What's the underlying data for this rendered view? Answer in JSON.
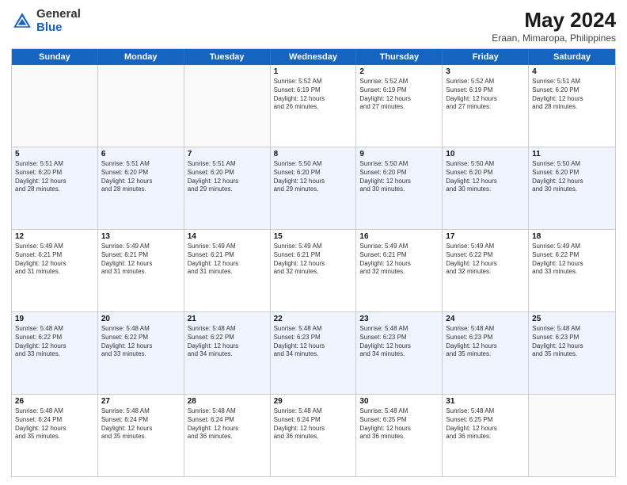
{
  "header": {
    "logo_general": "General",
    "logo_blue": "Blue",
    "month_year": "May 2024",
    "location": "Eraan, Mimaropa, Philippines"
  },
  "days_of_week": [
    "Sunday",
    "Monday",
    "Tuesday",
    "Wednesday",
    "Thursday",
    "Friday",
    "Saturday"
  ],
  "weeks": [
    [
      {
        "day": "",
        "info": ""
      },
      {
        "day": "",
        "info": ""
      },
      {
        "day": "",
        "info": ""
      },
      {
        "day": "1",
        "info": "Sunrise: 5:52 AM\nSunset: 6:19 PM\nDaylight: 12 hours\nand 26 minutes."
      },
      {
        "day": "2",
        "info": "Sunrise: 5:52 AM\nSunset: 6:19 PM\nDaylight: 12 hours\nand 27 minutes."
      },
      {
        "day": "3",
        "info": "Sunrise: 5:52 AM\nSunset: 6:19 PM\nDaylight: 12 hours\nand 27 minutes."
      },
      {
        "day": "4",
        "info": "Sunrise: 5:51 AM\nSunset: 6:20 PM\nDaylight: 12 hours\nand 28 minutes."
      }
    ],
    [
      {
        "day": "5",
        "info": "Sunrise: 5:51 AM\nSunset: 6:20 PM\nDaylight: 12 hours\nand 28 minutes."
      },
      {
        "day": "6",
        "info": "Sunrise: 5:51 AM\nSunset: 6:20 PM\nDaylight: 12 hours\nand 28 minutes."
      },
      {
        "day": "7",
        "info": "Sunrise: 5:51 AM\nSunset: 6:20 PM\nDaylight: 12 hours\nand 29 minutes."
      },
      {
        "day": "8",
        "info": "Sunrise: 5:50 AM\nSunset: 6:20 PM\nDaylight: 12 hours\nand 29 minutes."
      },
      {
        "day": "9",
        "info": "Sunrise: 5:50 AM\nSunset: 6:20 PM\nDaylight: 12 hours\nand 30 minutes."
      },
      {
        "day": "10",
        "info": "Sunrise: 5:50 AM\nSunset: 6:20 PM\nDaylight: 12 hours\nand 30 minutes."
      },
      {
        "day": "11",
        "info": "Sunrise: 5:50 AM\nSunset: 6:20 PM\nDaylight: 12 hours\nand 30 minutes."
      }
    ],
    [
      {
        "day": "12",
        "info": "Sunrise: 5:49 AM\nSunset: 6:21 PM\nDaylight: 12 hours\nand 31 minutes."
      },
      {
        "day": "13",
        "info": "Sunrise: 5:49 AM\nSunset: 6:21 PM\nDaylight: 12 hours\nand 31 minutes."
      },
      {
        "day": "14",
        "info": "Sunrise: 5:49 AM\nSunset: 6:21 PM\nDaylight: 12 hours\nand 31 minutes."
      },
      {
        "day": "15",
        "info": "Sunrise: 5:49 AM\nSunset: 6:21 PM\nDaylight: 12 hours\nand 32 minutes."
      },
      {
        "day": "16",
        "info": "Sunrise: 5:49 AM\nSunset: 6:21 PM\nDaylight: 12 hours\nand 32 minutes."
      },
      {
        "day": "17",
        "info": "Sunrise: 5:49 AM\nSunset: 6:22 PM\nDaylight: 12 hours\nand 32 minutes."
      },
      {
        "day": "18",
        "info": "Sunrise: 5:49 AM\nSunset: 6:22 PM\nDaylight: 12 hours\nand 33 minutes."
      }
    ],
    [
      {
        "day": "19",
        "info": "Sunrise: 5:48 AM\nSunset: 6:22 PM\nDaylight: 12 hours\nand 33 minutes."
      },
      {
        "day": "20",
        "info": "Sunrise: 5:48 AM\nSunset: 6:22 PM\nDaylight: 12 hours\nand 33 minutes."
      },
      {
        "day": "21",
        "info": "Sunrise: 5:48 AM\nSunset: 6:22 PM\nDaylight: 12 hours\nand 34 minutes."
      },
      {
        "day": "22",
        "info": "Sunrise: 5:48 AM\nSunset: 6:23 PM\nDaylight: 12 hours\nand 34 minutes."
      },
      {
        "day": "23",
        "info": "Sunrise: 5:48 AM\nSunset: 6:23 PM\nDaylight: 12 hours\nand 34 minutes."
      },
      {
        "day": "24",
        "info": "Sunrise: 5:48 AM\nSunset: 6:23 PM\nDaylight: 12 hours\nand 35 minutes."
      },
      {
        "day": "25",
        "info": "Sunrise: 5:48 AM\nSunset: 6:23 PM\nDaylight: 12 hours\nand 35 minutes."
      }
    ],
    [
      {
        "day": "26",
        "info": "Sunrise: 5:48 AM\nSunset: 6:24 PM\nDaylight: 12 hours\nand 35 minutes."
      },
      {
        "day": "27",
        "info": "Sunrise: 5:48 AM\nSunset: 6:24 PM\nDaylight: 12 hours\nand 35 minutes."
      },
      {
        "day": "28",
        "info": "Sunrise: 5:48 AM\nSunset: 6:24 PM\nDaylight: 12 hours\nand 36 minutes."
      },
      {
        "day": "29",
        "info": "Sunrise: 5:48 AM\nSunset: 6:24 PM\nDaylight: 12 hours\nand 36 minutes."
      },
      {
        "day": "30",
        "info": "Sunrise: 5:48 AM\nSunset: 6:25 PM\nDaylight: 12 hours\nand 36 minutes."
      },
      {
        "day": "31",
        "info": "Sunrise: 5:48 AM\nSunset: 6:25 PM\nDaylight: 12 hours\nand 36 minutes."
      },
      {
        "day": "",
        "info": ""
      }
    ]
  ]
}
